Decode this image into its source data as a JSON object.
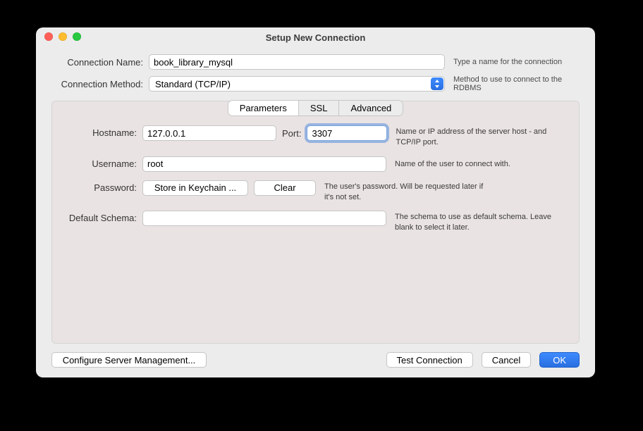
{
  "window": {
    "title": "Setup New Connection"
  },
  "top": {
    "name_label": "Connection Name:",
    "name_value": "book_library_mysql",
    "name_desc": "Type a name for the connection",
    "method_label": "Connection Method:",
    "method_value": "Standard (TCP/IP)",
    "method_desc": "Method to use to connect to the RDBMS"
  },
  "tabs": {
    "parameters": "Parameters",
    "ssl": "SSL",
    "advanced": "Advanced",
    "active": "parameters"
  },
  "params": {
    "hostname_label": "Hostname:",
    "hostname_value": "127.0.0.1",
    "port_label": "Port:",
    "port_value": "3307",
    "host_desc": "Name or IP address of the server host - and TCP/IP port.",
    "username_label": "Username:",
    "username_value": "root",
    "username_desc": "Name of the user to connect with.",
    "password_label": "Password:",
    "password_store": "Store in Keychain ...",
    "password_clear": "Clear",
    "password_desc": "The user's password. Will be requested later if it's not set.",
    "schema_label": "Default Schema:",
    "schema_value": "",
    "schema_desc": "The schema to use as default schema. Leave blank to select it later."
  },
  "footer": {
    "config": "Configure Server Management...",
    "test": "Test Connection",
    "cancel": "Cancel",
    "ok": "OK"
  }
}
